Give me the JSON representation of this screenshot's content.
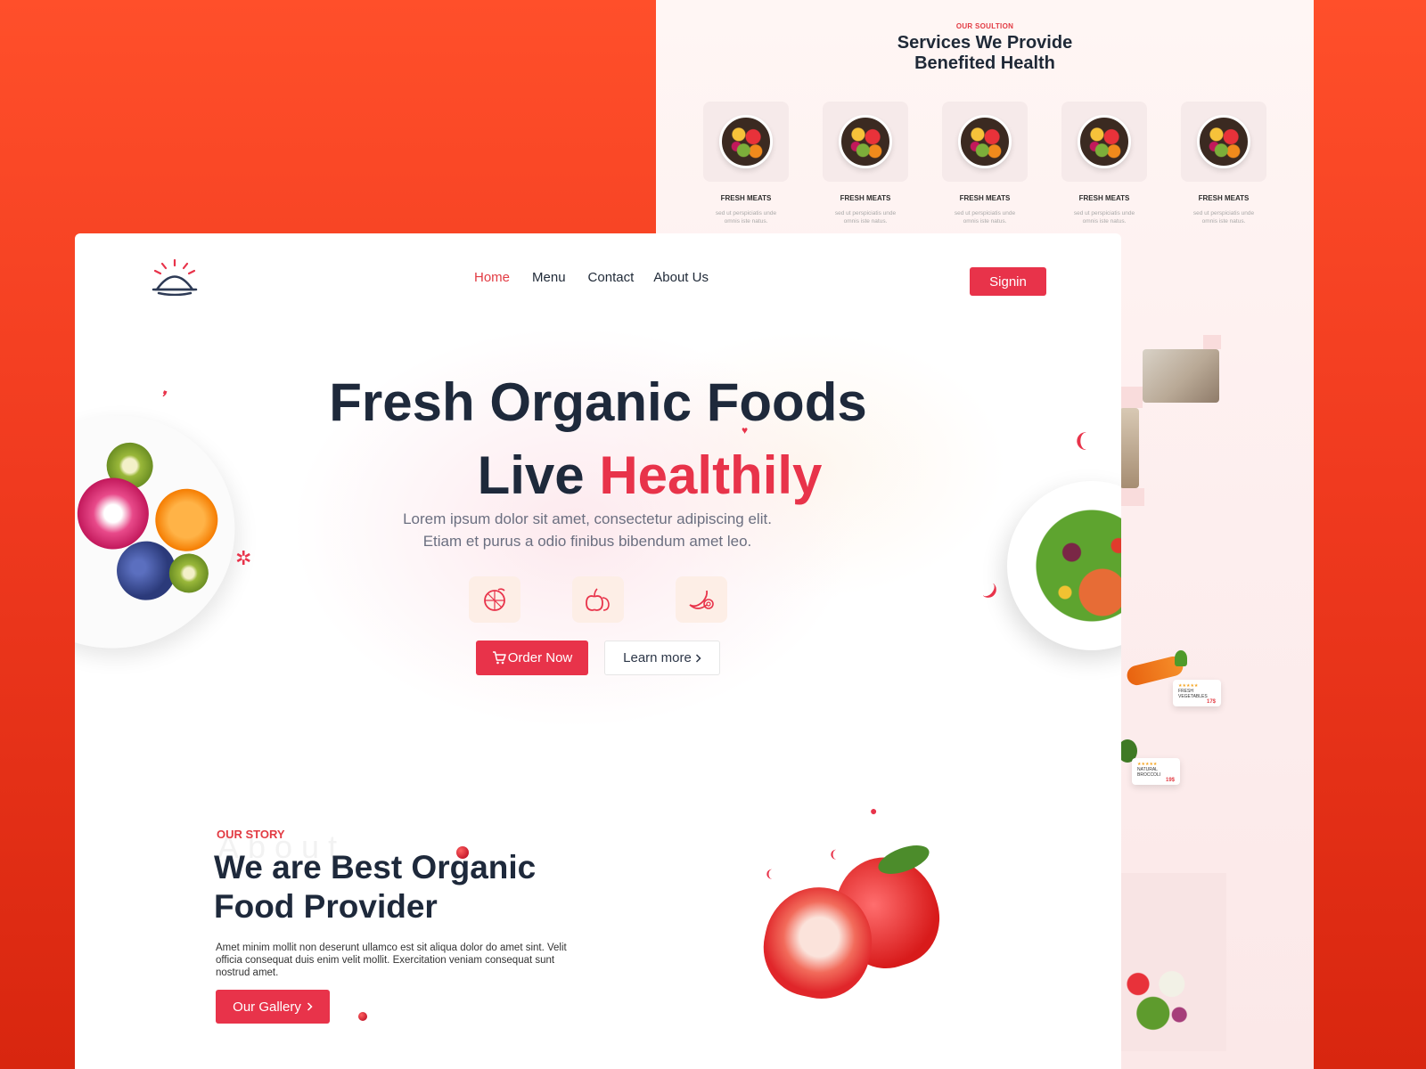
{
  "colors": {
    "accent": "#e8334a",
    "dark": "#1e293b",
    "background_orange": "#f03a1f"
  },
  "services_page": {
    "eyebrow": "OUR SOULTION",
    "title_line1": "Services We Provide",
    "title_line2": "Benefited Health",
    "cards": [
      {
        "name": "FRESH MEATS",
        "desc": "sed ut perspiciatis unde omnis iste natus."
      },
      {
        "name": "FRESH MEATS",
        "desc": "sed ut perspiciatis unde omnis iste natus."
      },
      {
        "name": "FRESH MEATS",
        "desc": "sed ut perspiciatis unde omnis iste natus."
      },
      {
        "name": "FRESH MEATS",
        "desc": "sed ut perspiciatis unde omnis iste natus."
      },
      {
        "name": "FRESH MEATS",
        "desc": "sed ut perspiciatis unde omnis iste natus."
      }
    ],
    "product_cards": [
      {
        "stars": "★★★★★",
        "name": "FRESH VEGETABLES",
        "price": "17$"
      },
      {
        "stars": "★★★★★",
        "name": "NATURAL BROCCOLI",
        "price": "19$"
      }
    ]
  },
  "header": {
    "logo_icon": "cloche-icon",
    "nav": [
      {
        "label": "Home",
        "active": true
      },
      {
        "label": "Menu",
        "active": false
      },
      {
        "label": "Contact",
        "active": false
      },
      {
        "label": "About Us",
        "active": false
      }
    ],
    "signin_label": "Signin"
  },
  "hero": {
    "title_line1": "Fresh Organic Foods",
    "title_line2_plain": "Live",
    "title_line2_accent": "Healthily",
    "subtitle_line1": "Lorem ipsum dolor sit amet, consectetur adipiscing elit.",
    "subtitle_line2": "Etiam et purus a odio finibus bibendum amet leo.",
    "feature_icons": [
      "citrus-icon",
      "fruits-icon",
      "banana-icon"
    ],
    "order_label": "Order Now",
    "order_icon": "cart-icon",
    "learn_label": "Learn more",
    "learn_icon": "chevron-right-icon"
  },
  "about": {
    "eyebrow": "OUR STORY",
    "watermark": "About",
    "title": "We are Best Organic Food Provider",
    "text": "Amet minim mollit non deserunt ullamco est sit aliqua dolor do amet sint. Velit officia consequat duis enim velit mollit. Exercitation veniam consequat sunt nostrud amet.",
    "gallery_label": "Our Gallery",
    "gallery_icon": "chevron-right-icon"
  }
}
